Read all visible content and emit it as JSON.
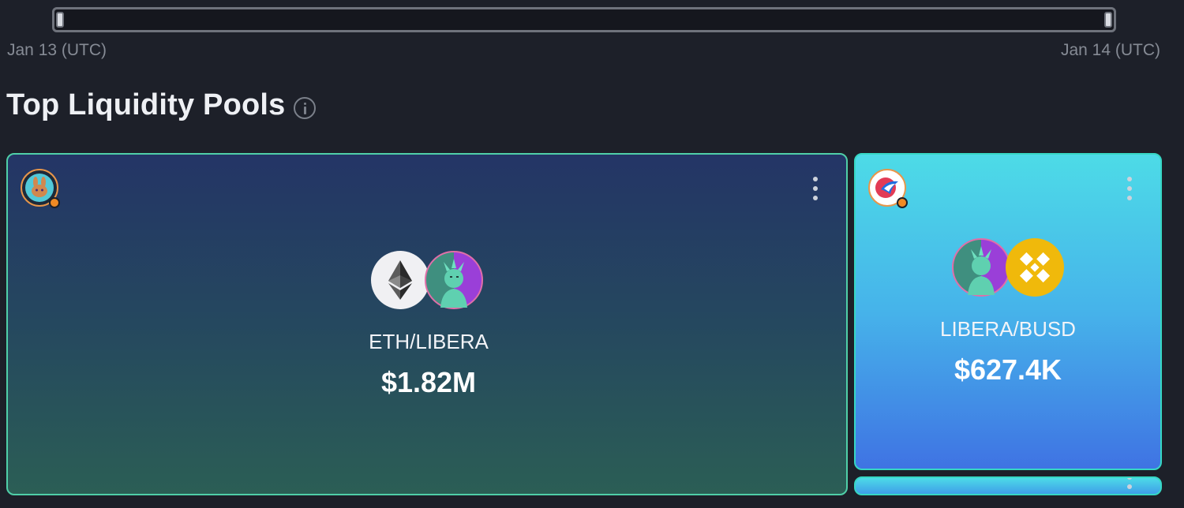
{
  "timeline": {
    "start_label": "Jan 13 (UTC)",
    "end_label": "Jan 14 (UTC)"
  },
  "section": {
    "title": "Top Liquidity Pools",
    "info_icon": "info-icon"
  },
  "pools": [
    {
      "dex_icon": "pancakeswap-bunny-icon",
      "pair": "ETH/LIBERA",
      "value": "$1.82M",
      "tokens": [
        "ethereum-icon",
        "libera-statue-icon"
      ],
      "menu_icon": "more-vertical-icon"
    },
    {
      "dex_icon": "biswap-bird-icon",
      "pair": "LIBERA/BUSD",
      "value": "$627.4K",
      "tokens": [
        "libera-statue-icon",
        "busd-icon"
      ],
      "menu_icon": "more-vertical-icon"
    }
  ],
  "colors": {
    "background": "#1d2029",
    "card_border": "#4fcfa8",
    "status_dot": "#f08a24",
    "busd": "#f0b90b"
  }
}
